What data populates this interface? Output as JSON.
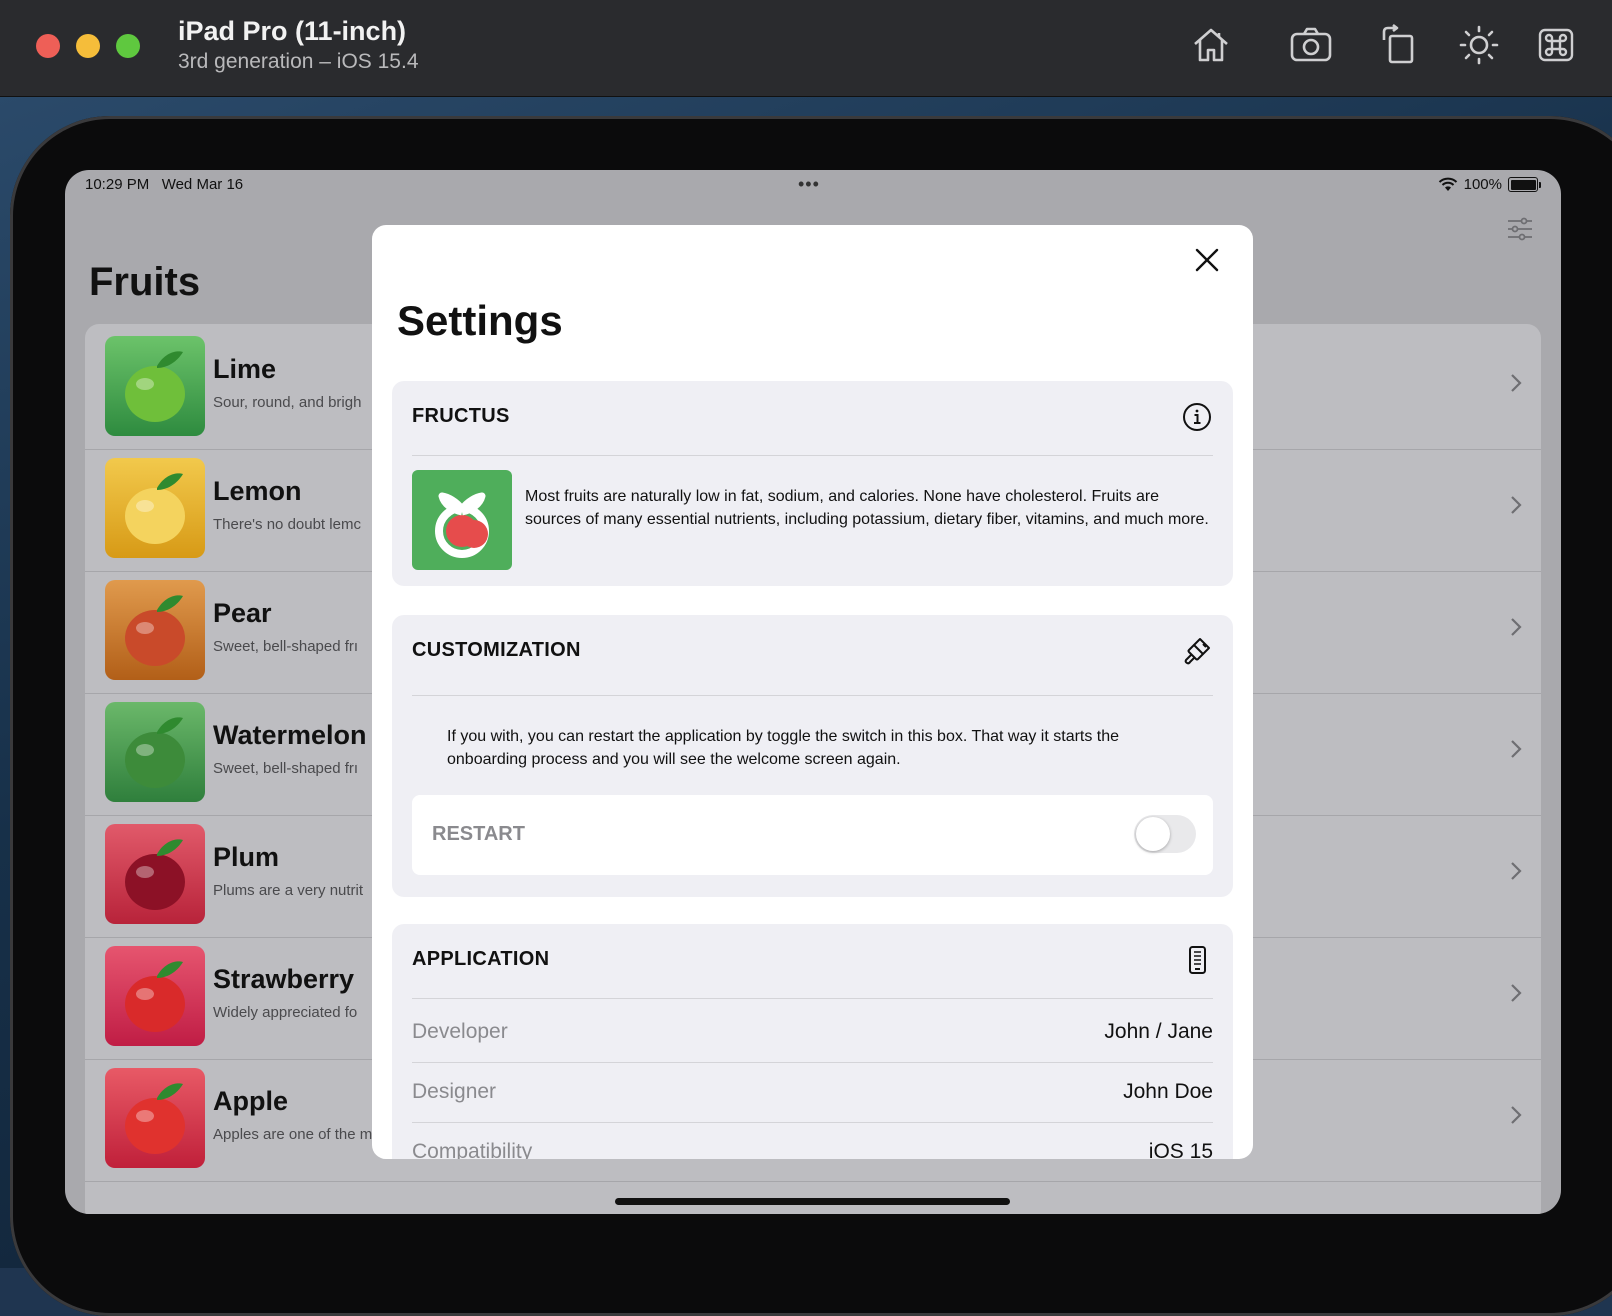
{
  "simulator": {
    "device_name": "iPad Pro (11-inch)",
    "device_detail": "3rd generation – iOS 15.4",
    "tools": [
      "home-icon",
      "screenshot-icon",
      "rotate-icon",
      "appearance-icon",
      "command-icon"
    ]
  },
  "status_bar": {
    "time_date": "10:29 PM   Wed Mar 16",
    "dots": "•••",
    "battery": "100%"
  },
  "list": {
    "title": "Fruits",
    "items": [
      {
        "name": "Lime",
        "desc": "Sour, round, and brigh",
        "color_top": "#6cc36a",
        "color_bottom": "#2e8b3f",
        "fruit": "#6fbf3a"
      },
      {
        "name": "Lemon",
        "desc": "There's no doubt lemc",
        "color_top": "#f2c94c",
        "color_bottom": "#d79a16",
        "fruit": "#f4d35e"
      },
      {
        "name": "Pear",
        "desc": "Sweet, bell-shaped frı",
        "color_top": "#e09a4d",
        "color_bottom": "#b25f18",
        "fruit": "#c94a2a"
      },
      {
        "name": "Watermelon",
        "desc": "Sweet, bell-shaped frı",
        "color_top": "#6bb86a",
        "color_bottom": "#2f7f3c",
        "fruit": "#3d8b3a"
      },
      {
        "name": "Plum",
        "desc": "Plums are a very nutrit",
        "color_top": "#e15a6a",
        "color_bottom": "#b8233a",
        "fruit": "#8c1126"
      },
      {
        "name": "Strawberry",
        "desc": "Widely appreciated fo",
        "color_top": "#e6556f",
        "color_bottom": "#c01d45",
        "fruit": "#d92a2a"
      },
      {
        "name": "Apple",
        "desc": "Apples are one of the most popular, and exceptionally healthy fruit for good reason.",
        "color_top": "#e85a66",
        "color_bottom": "#c0203a",
        "fruit": "#e0322e"
      }
    ]
  },
  "settings": {
    "title": "Settings",
    "fructus": {
      "heading": "FRUCTUS",
      "text": "Most fruits are naturally low in fat, sodium, and calories. None have cholesterol. Fruits are sources of many essential nutrients, including potassium, dietary fiber, vitamins, and much more."
    },
    "customization": {
      "heading": "CUSTOMIZATION",
      "text": "If you with, you can restart the application by toggle the switch in this box. That way it starts the onboarding process and you will see the welcome screen again.",
      "restart_label": "RESTART"
    },
    "application": {
      "heading": "APPLICATION",
      "rows": [
        {
          "key": "Developer",
          "value": "John / Jane"
        },
        {
          "key": "Designer",
          "value": "John Doe"
        },
        {
          "key": "Compatibility",
          "value": "iOS 15"
        }
      ]
    }
  }
}
